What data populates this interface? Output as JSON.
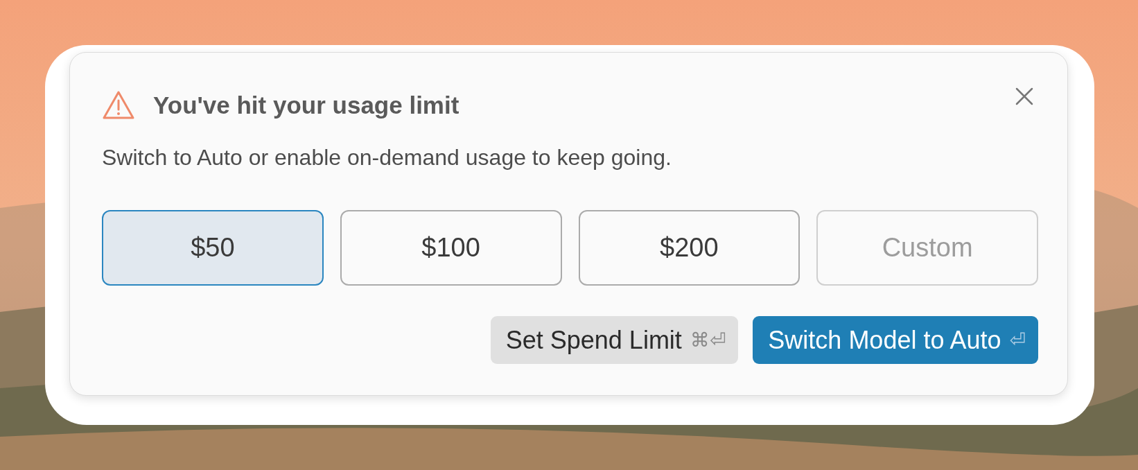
{
  "dialog": {
    "title": "You've hit your usage limit",
    "message": "Switch to Auto or enable on-demand usage to keep going.",
    "amounts": [
      {
        "label": "$50",
        "selected": true,
        "kind": "preset"
      },
      {
        "label": "$100",
        "selected": false,
        "kind": "preset"
      },
      {
        "label": "$200",
        "selected": false,
        "kind": "preset"
      },
      {
        "label": "Custom",
        "selected": false,
        "kind": "custom"
      }
    ],
    "actions": [
      {
        "label": "Set Spend Limit",
        "shortcut": "⌘⏎",
        "kind": "secondary"
      },
      {
        "label": "Switch Model to Auto",
        "shortcut": "⏎",
        "kind": "primary"
      }
    ]
  }
}
